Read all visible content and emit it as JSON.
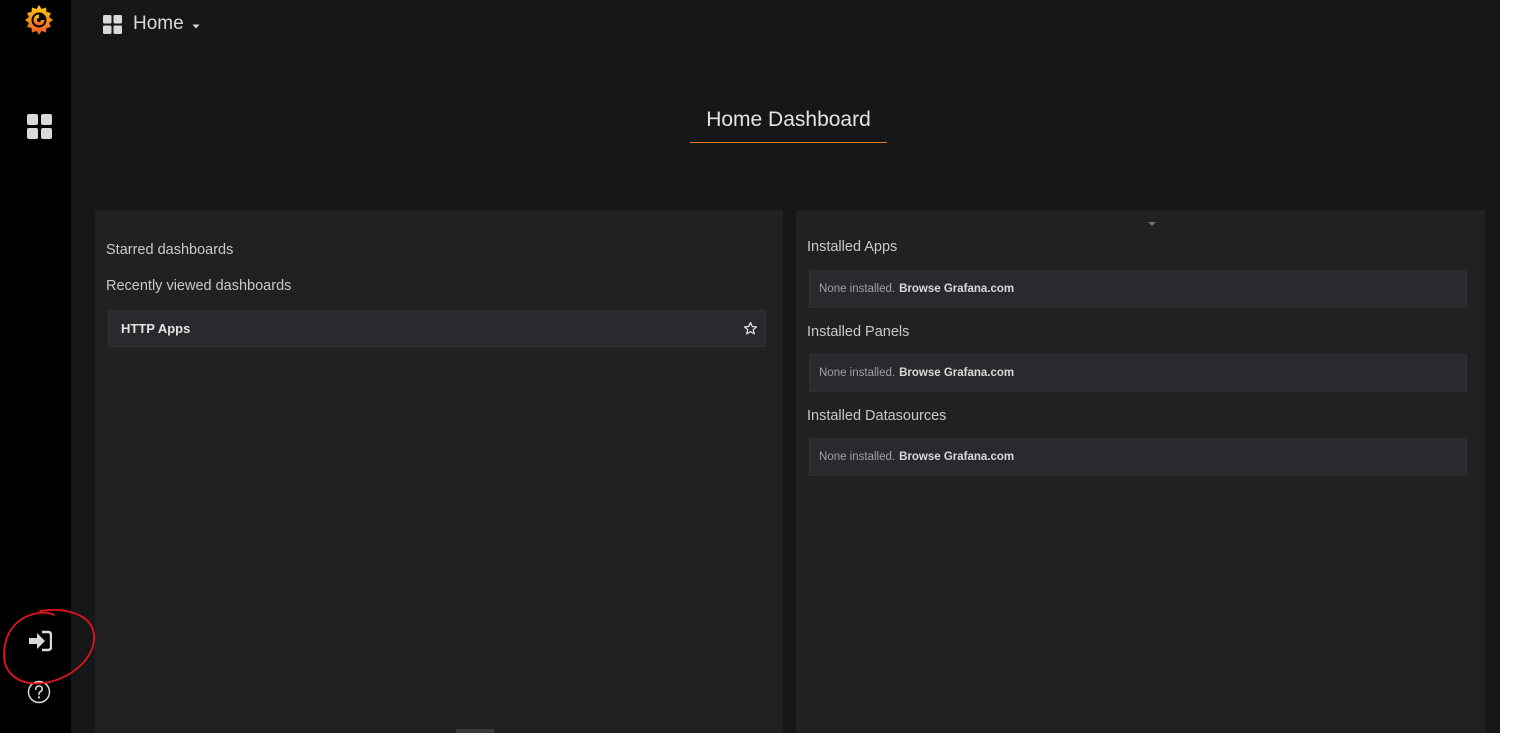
{
  "nav": {
    "title": "Home"
  },
  "dashboard": {
    "title": "Home Dashboard"
  },
  "left_panel": {
    "starred_label": "Starred dashboards",
    "recent_label": "Recently viewed dashboards",
    "recent_items": [
      {
        "name": "HTTP Apps"
      }
    ]
  },
  "right_panel": {
    "sections": [
      {
        "label": "Installed Apps",
        "text": "None installed.",
        "link": "Browse Grafana.com"
      },
      {
        "label": "Installed Panels",
        "text": "None installed.",
        "link": "Browse Grafana.com"
      },
      {
        "label": "Installed Datasources",
        "text": "None installed.",
        "link": "Browse Grafana.com"
      }
    ]
  },
  "icons": {
    "logo": "grafana-logo-icon",
    "dashboards": "dashboards-grid-icon",
    "sign_in": "sign-in-icon",
    "help": "help-icon",
    "star": "star-outline-icon",
    "caret": "caret-down-icon"
  },
  "colors": {
    "accent": "#eb7b18",
    "background": "#161719",
    "panel": "#212124",
    "sidebar": "#000000",
    "annotation": "#e0141e"
  }
}
